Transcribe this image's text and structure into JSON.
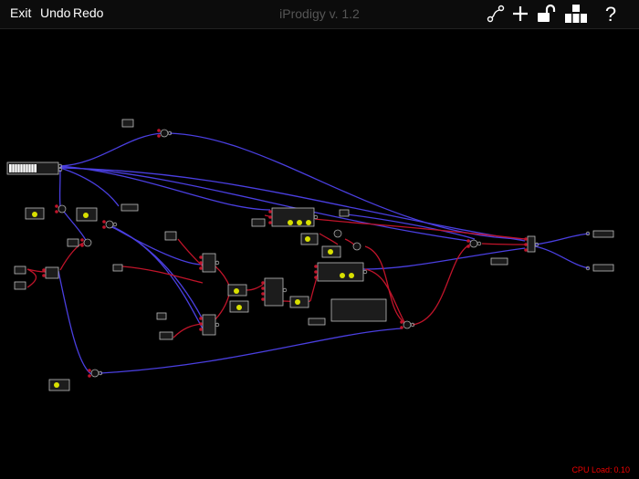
{
  "toolbar": {
    "exit_label": "Exit",
    "undo_label": "Undo",
    "redo_label": "Redo",
    "title": "iProdigy v. 1.2",
    "icons": [
      "connect-icon",
      "add-icon",
      "unlock-icon",
      "modules-icon",
      "help-icon"
    ]
  },
  "status": {
    "cpu_label": "CPU Load:",
    "cpu_value": "0.10"
  },
  "colors": {
    "background": "#000000",
    "module": "#1c1c1c",
    "module_border": "#bdbdbd",
    "wire_blue": "#4a3fe0",
    "wire_red": "#c0142a",
    "knob": "#d8e000",
    "cpu_text": "#e00000"
  }
}
